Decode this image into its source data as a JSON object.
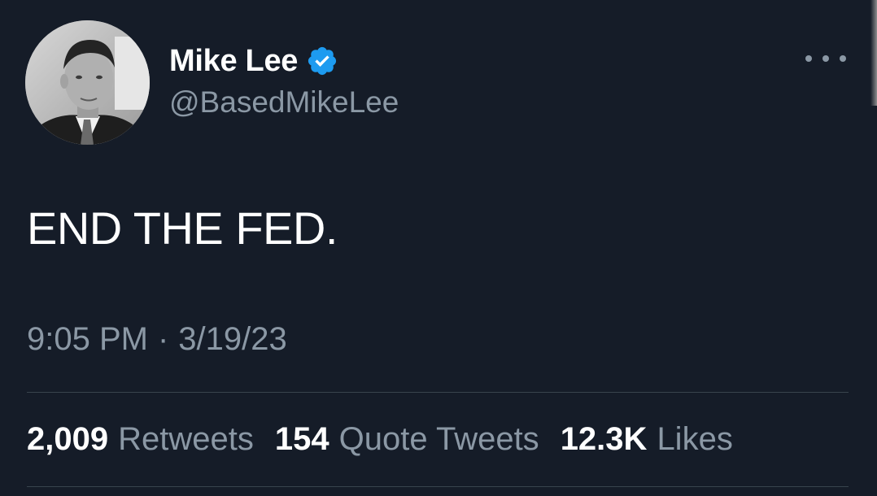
{
  "tweet": {
    "author": {
      "display_name": "Mike Lee",
      "handle": "@BasedMikeLee",
      "verified": true
    },
    "text": "END THE FED.",
    "time": "9:05 PM",
    "separator": "·",
    "date": "3/19/23",
    "stats": [
      {
        "count": "2,009",
        "label": "Retweets"
      },
      {
        "count": "154",
        "label": "Quote Tweets"
      },
      {
        "count": "12.3K",
        "label": "Likes"
      }
    ]
  },
  "icons": {
    "verified": "verified-badge-icon",
    "more": "more-options-icon"
  },
  "colors": {
    "background": "#151c28",
    "text": "#ffffff",
    "secondary": "#8b98a5",
    "divider": "#38444d",
    "verified": "#1d9bf0"
  }
}
